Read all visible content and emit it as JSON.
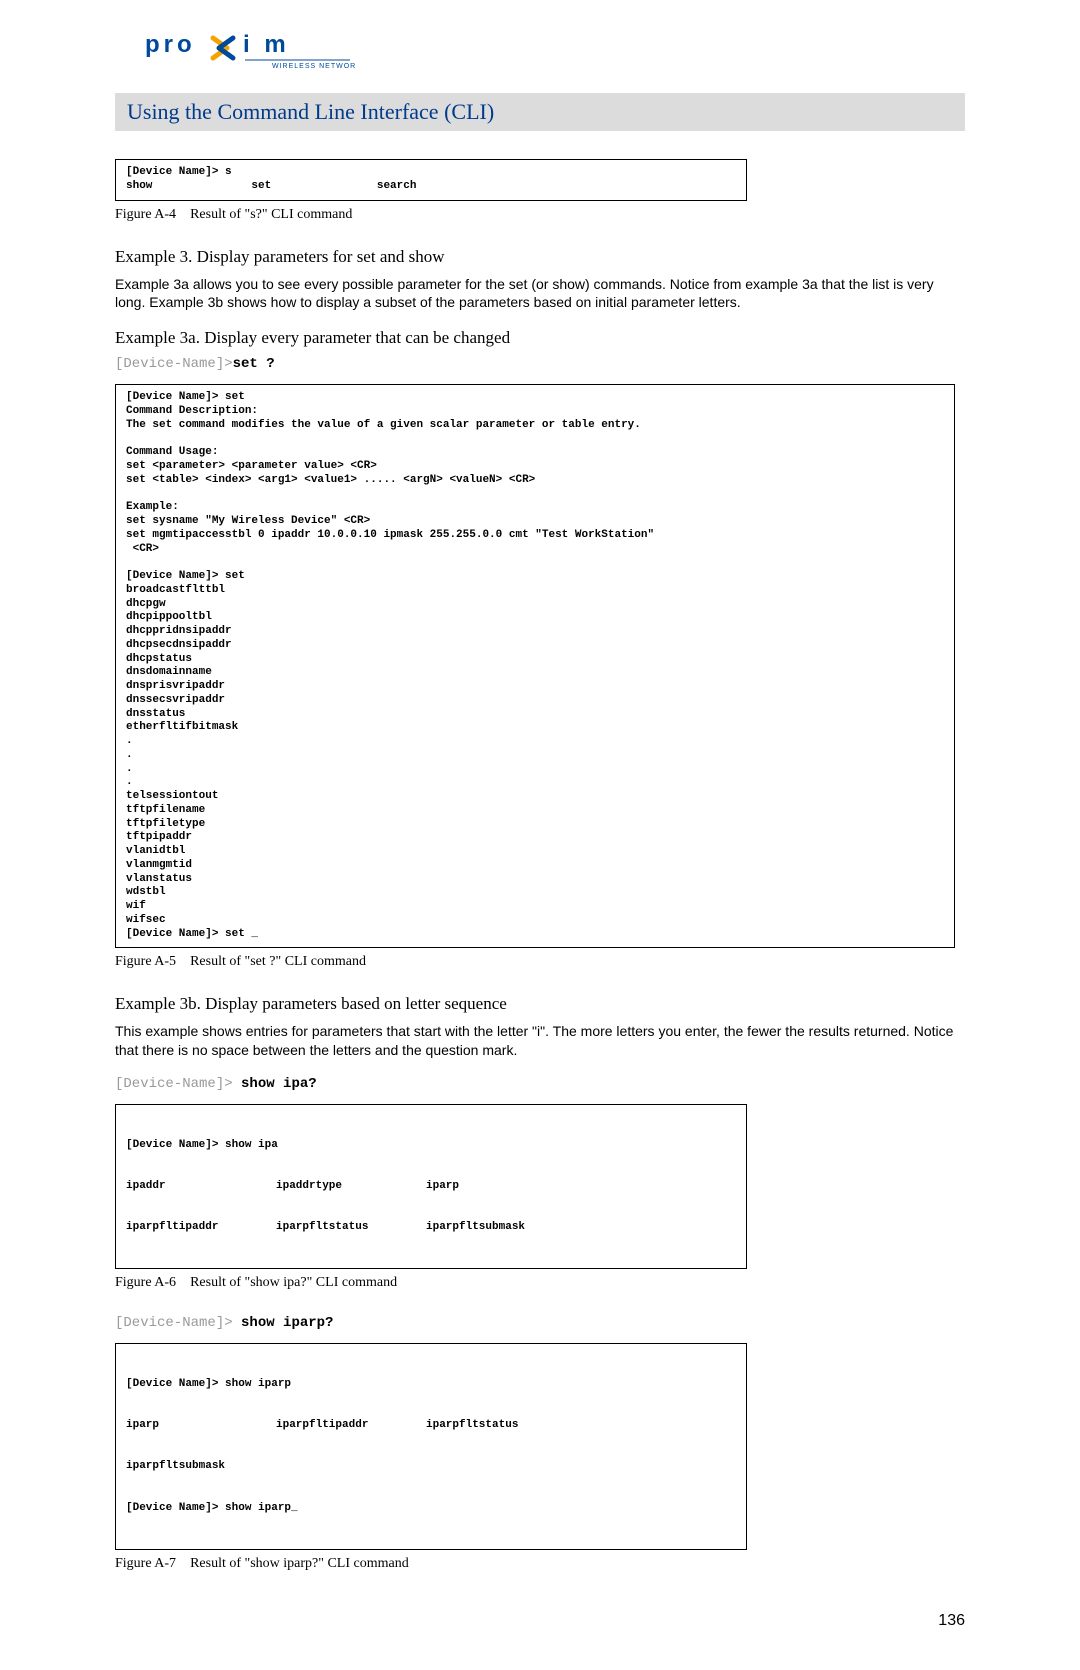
{
  "logo": {
    "brand": "proxim",
    "tagline": "WIRELESS NETWORKS"
  },
  "title": "Using the Command Line Interface (CLI)",
  "figA4": {
    "box": "[Device Name]> s\nshow               set                search",
    "caption_label": "Figure A-4",
    "caption_text": "Result of \"s?\" CLI command"
  },
  "ex3": {
    "heading": "Example 3. Display parameters for set and show",
    "body": "Example 3a allows you to see every possible parameter for the set (or show) commands. Notice from example 3a that the list is very long. Example 3b shows how to display a subset of the parameters based on initial parameter letters."
  },
  "ex3a": {
    "heading": "Example 3a. Display every parameter that can be changed",
    "cmd_prefix": "[Device-Name]>",
    "cmd_bold": "set ?",
    "box": "[Device Name]> set\nCommand Description:\nThe set command modifies the value of a given scalar parameter or table entry.\n\nCommand Usage:\nset <parameter> <parameter value> <CR>\nset <table> <index> <arg1> <value1> ..... <argN> <valueN> <CR>\n\nExample:\nset sysname \"My Wireless Device\" <CR>\nset mgmtipaccesstbl 0 ipaddr 10.0.0.10 ipmask 255.255.0.0 cmt \"Test WorkStation\"\n <CR>\n\n[Device Name]> set\nbroadcastflttbl\ndhcpgw\ndhcpippooltbl\ndhcppridnsipaddr\ndhcpsecdnsipaddr\ndhcpstatus\ndnsdomainname\ndnsprisvripaddr\ndnssecsvripaddr\ndnsstatus\netherfltifbitmask\n.\n.\n.\n.\ntelsessiontout\ntftpfilename\ntftpfiletype\ntftpipaddr\nvlanidtbl\nvlanmgmtid\nvlanstatus\nwdstbl\nwif\nwifsec\n[Device Name]> set _"
  },
  "figA5": {
    "caption_label": "Figure A-5",
    "caption_text": "Result of \"set ?\" CLI command"
  },
  "ex3b": {
    "heading": "Example 3b. Display parameters based on letter sequence",
    "body": "This example shows entries for parameters that start with the letter \"i\". The more letters you enter, the fewer the results returned. Notice that there is no space between the letters and the question mark.",
    "cmd1_prefix": "[Device-Name]> ",
    "cmd1_bold": "show ipa?",
    "box1_l1c1": "[Device Name]> show ipa",
    "box1_l2c1": "ipaddr",
    "box1_l2c2": "ipaddrtype",
    "box1_l2c3": "iparp",
    "box1_l3c1": "iparpfltipaddr",
    "box1_l3c2": "iparpfltstatus",
    "box1_l3c3": "iparpfltsubmask",
    "figA6_label": "Figure A-6",
    "figA6_text": "Result of \"show ipa?\" CLI command",
    "cmd2_prefix": "[Device-Name]> ",
    "cmd2_bold": "show iparp?",
    "box2_l1": "[Device Name]> show iparp",
    "box2_l2c1": "iparp",
    "box2_l2c2": "iparpfltipaddr",
    "box2_l2c3": "iparpfltstatus",
    "box2_l3c1": "iparpfltsubmask",
    "box2_l4": "[Device Name]> show iparp_",
    "figA7_label": "Figure A-7",
    "figA7_text": "Result of \"show iparp?\" CLI command"
  },
  "page_number": "136"
}
